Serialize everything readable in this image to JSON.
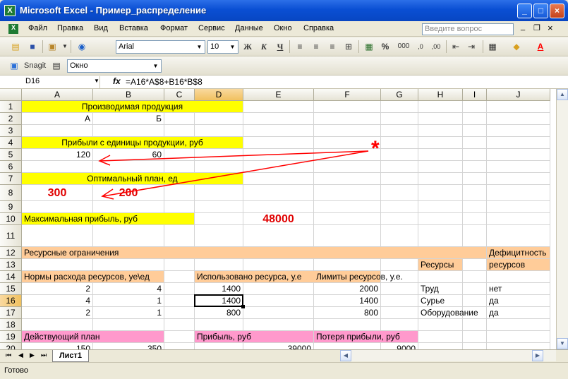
{
  "window": {
    "title": "Microsoft Excel - Пример_распределение",
    "app_icon": "X",
    "min": "_",
    "max": "□",
    "close": "×"
  },
  "menu": {
    "items": [
      "Файл",
      "Правка",
      "Вид",
      "Вставка",
      "Формат",
      "Сервис",
      "Данные",
      "Окно",
      "Справка"
    ],
    "help_placeholder": "Введите вопрос",
    "doc_min": "_",
    "doc_restore": "❐",
    "doc_close": "×"
  },
  "toolbar": {
    "font": "Arial",
    "size": "10",
    "bold": "Ж",
    "italic": "К",
    "underline": "Ч",
    "percent": "%",
    "thousands": "000",
    "snagit": "Snagit",
    "window_combo": "Окно"
  },
  "formula_bar": {
    "cell_ref": "D16",
    "fx": "fx",
    "formula": "=A16*A$8+B16*B$8"
  },
  "columns": [
    "A",
    "B",
    "C",
    "D",
    "E",
    "F",
    "G",
    "H",
    "I",
    "J"
  ],
  "rows": [
    "1",
    "2",
    "3",
    "4",
    "5",
    "6",
    "7",
    "8",
    "9",
    "10",
    "11",
    "12",
    "13",
    "14",
    "15",
    "16",
    "17",
    "18",
    "19",
    "20"
  ],
  "cells": {
    "r1": "Производимая продукция",
    "r2a": "А",
    "r2b": "Б",
    "r4": "Прибыли с единицы продукции, руб",
    "r5a": "120",
    "r5b": "60",
    "r7": "Оптимальный план, ед",
    "r8a": "300",
    "r8b": "200",
    "r10a": "Максимальная прибыль, руб",
    "r10e": "48000",
    "r12": "Ресурсные ограничения",
    "r13h": "Ресурсы",
    "r12j": "Дефицитность",
    "r13j": "ресурсов",
    "r14a": "Нормы расхода ресурсов, уе\\ед",
    "r14d": "Использовано ресурса, у.е",
    "r14f": "Лимиты ресурсов, у.е.",
    "r15a": "2",
    "r15b": "4",
    "r15d": "1400",
    "r15f": "2000",
    "r15h": "Труд",
    "r15j": "нет",
    "r16a": "4",
    "r16b": "1",
    "r16d": "1400",
    "r16f": "1400",
    "r16h": "Сурье",
    "r16j": "да",
    "r17a": "2",
    "r17b": "1",
    "r17d": "800",
    "r17f": "800",
    "r17h": "Оборудование",
    "r17j": "да",
    "r19a": "Действующий план",
    "r19d": "Прибыль, руб",
    "r19f": "Потеря прибыли, руб",
    "r20a": "150",
    "r20b": "350",
    "r20e": "39000",
    "r20g": "9000"
  },
  "annotation": {
    "star": "*",
    "color": "#ff0000"
  },
  "sheet_tab": "Лист1",
  "status": "Готово",
  "colors": {
    "yellow": "#ffff00",
    "peach": "#ffcc99",
    "pink": "#ff99cc",
    "red": "#ff0000"
  }
}
